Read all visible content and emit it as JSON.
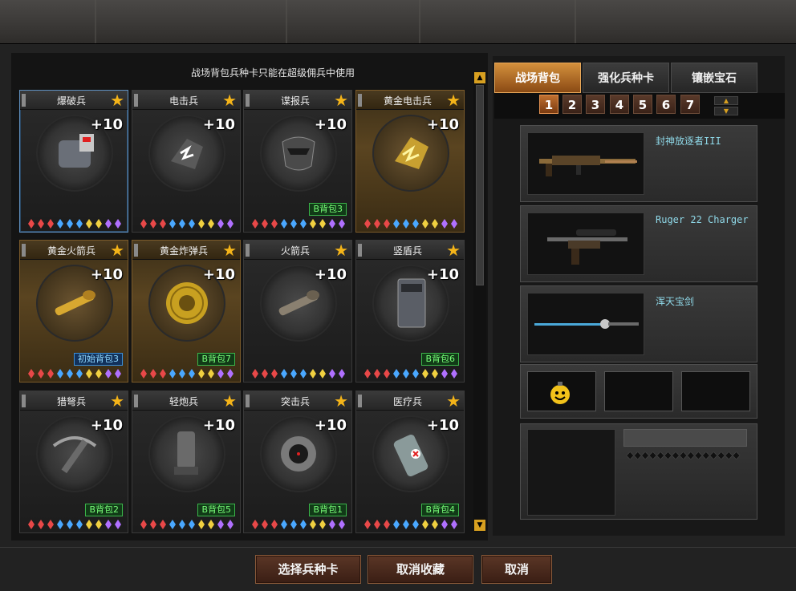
{
  "hint": "战场背包兵种卡只能在超级佣兵中使用",
  "cards": [
    {
      "name": "爆破兵",
      "bonus": "+10",
      "badge": "",
      "gold": false,
      "selected": true,
      "icon": "c4-bomb-icon"
    },
    {
      "name": "电击兵",
      "bonus": "+10",
      "badge": "",
      "gold": false,
      "selected": false,
      "icon": "electric-gauntlet-icon"
    },
    {
      "name": "谍报兵",
      "bonus": "+10",
      "badge": "B背包3",
      "gold": false,
      "selected": false,
      "icon": "spy-mask-icon"
    },
    {
      "name": "黄金电击兵",
      "bonus": "+10",
      "badge": "",
      "gold": true,
      "selected": false,
      "icon": "gold-electric-gauntlet-icon"
    },
    {
      "name": "黄金火箭兵",
      "bonus": "+10",
      "badge": "初始背包3",
      "gold": true,
      "selected": false,
      "icon": "gold-rocket-launcher-icon"
    },
    {
      "name": "黄金炸弹兵",
      "bonus": "+10",
      "badge": "B背包7",
      "gold": true,
      "selected": false,
      "icon": "gold-bomb-ball-icon"
    },
    {
      "name": "火箭兵",
      "bonus": "+10",
      "badge": "",
      "gold": false,
      "selected": false,
      "icon": "rocket-launcher-icon"
    },
    {
      "name": "竖盾兵",
      "bonus": "+10",
      "badge": "B背包6",
      "gold": false,
      "selected": false,
      "icon": "riot-shield-icon"
    },
    {
      "name": "猎弩兵",
      "bonus": "+10",
      "badge": "B背包2",
      "gold": false,
      "selected": false,
      "icon": "crossbow-icon"
    },
    {
      "name": "轻炮兵",
      "bonus": "+10",
      "badge": "B背包5",
      "gold": false,
      "selected": false,
      "icon": "mortar-icon"
    },
    {
      "name": "突击兵",
      "bonus": "+10",
      "badge": "B背包1",
      "gold": false,
      "selected": false,
      "icon": "mine-device-icon"
    },
    {
      "name": "医疗兵",
      "bonus": "+10",
      "badge": "B背包4",
      "gold": false,
      "selected": false,
      "icon": "medkit-canister-icon"
    }
  ],
  "gem_colors": [
    "#e84848",
    "#e84848",
    "#e84848",
    "#4aa8ff",
    "#4aa8ff",
    "#4aa8ff",
    "#f0d040",
    "#f0d040",
    "#b070ff",
    "#b070ff"
  ],
  "tabs": [
    "战场背包",
    "强化兵种卡",
    "镶嵌宝石"
  ],
  "pages": [
    "1",
    "2",
    "3",
    "4",
    "5",
    "6",
    "7"
  ],
  "active_page": "1",
  "weapons": [
    {
      "name": "封神放逐者III",
      "icon": "machine-gun-icon"
    },
    {
      "name": "Ruger 22 Charger",
      "icon": "sniper-pistol-icon"
    },
    {
      "name": "浑天宝剑",
      "icon": "sword-icon"
    }
  ],
  "accessory_icon": "smiley-grenade-icon",
  "info_diamonds": "◆◆◆◆◆◆◆◆◆◆◆◆◆◆◆",
  "buttons": {
    "select": "选择兵种卡",
    "unfav": "取消收藏",
    "cancel": "取消"
  },
  "colors": {
    "accent_orange": "#d4903c",
    "star": "#f4b419",
    "badge_green": "#79ff79",
    "badge_blue": "#8fd8ff",
    "weapon_text": "#8fd8e8"
  }
}
